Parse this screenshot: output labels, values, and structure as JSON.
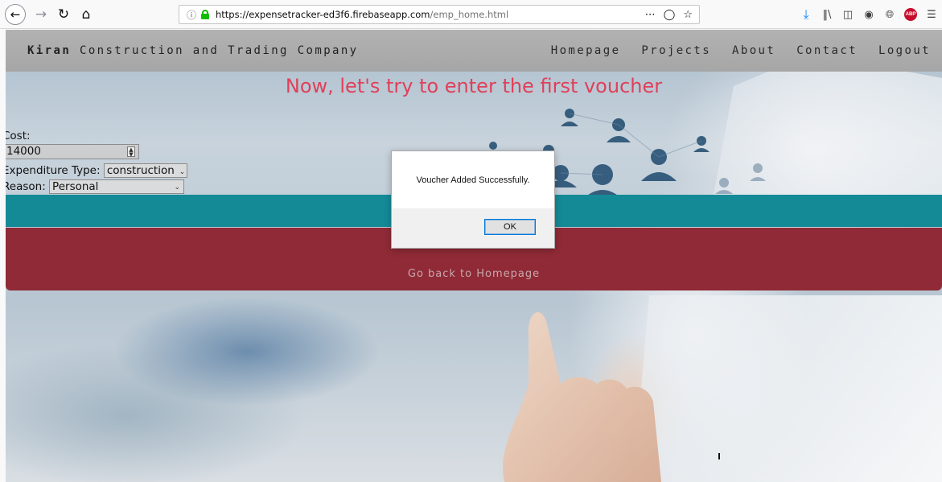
{
  "browser": {
    "url_domain": "https://expensetracker-ed3f6.firebaseapp.com",
    "url_path": "/emp_home.html",
    "icons": [
      "back-icon",
      "forward-icon",
      "reload-icon",
      "home-icon",
      "info-icon",
      "lock-icon",
      "page-actions-icon",
      "pocket-icon",
      "bookmark-star-icon",
      "download-icon",
      "library-icon",
      "sidebar-icon",
      "account-icon",
      "globe-icon",
      "adblock-icon",
      "menu-icon"
    ],
    "adblock_label": "ABP"
  },
  "site_nav": {
    "brand_bold": "Kiran",
    "brand_rest": " Construction and Trading Company",
    "links": [
      "Homepage",
      "Projects",
      "About",
      "Contact",
      "Logout"
    ]
  },
  "headline": "Now, let's try to enter the first voucher",
  "form": {
    "cost_label": "Cost:",
    "cost_value": "14000",
    "expenditure_label": "Expenditure Type:",
    "expenditure_value": "construction",
    "reason_label": "Reason:",
    "reason_value": "Personal"
  },
  "back_link": "Go back to Homepage",
  "dialog": {
    "message": "Voucher Added Successfully.",
    "ok_label": "OK"
  },
  "colors": {
    "headline": "#e0405a",
    "teal_bar": "#148a97",
    "red_block": "#8f2a36",
    "nav_bar": "#b2b2b2"
  }
}
